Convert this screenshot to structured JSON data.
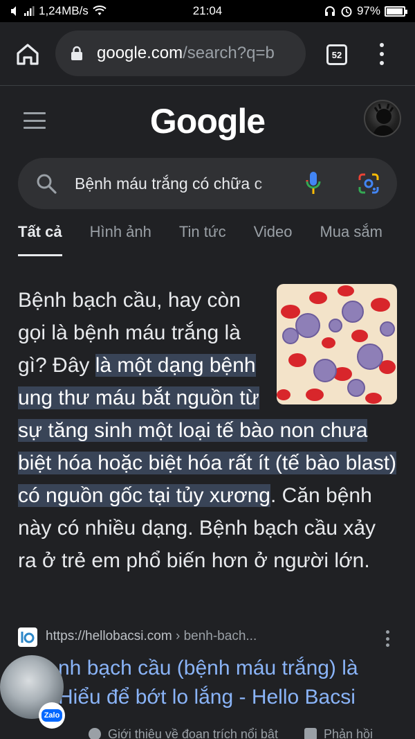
{
  "status_bar": {
    "speed": "1,24MB/s",
    "time": "21:04",
    "battery": "97%",
    "battery_level": 0.97
  },
  "browser": {
    "url_host": "google.com",
    "url_path": "/search?q=b",
    "tab_count": "52"
  },
  "header": {
    "logo": "Google"
  },
  "search": {
    "query": "Bệnh máu trắng có chữa c"
  },
  "tabs": [
    {
      "label": "Tất cả",
      "active": true
    },
    {
      "label": "Hình ảnh",
      "active": false
    },
    {
      "label": "Tin tức",
      "active": false
    },
    {
      "label": "Video",
      "active": false
    },
    {
      "label": "Mua sắm",
      "active": false
    }
  ],
  "snippet": {
    "pre": "Bệnh bạch cầu, hay còn gọi là bệnh máu trắng là gì? Đây ",
    "highlight": "là một dạng bệnh ung thư máu bắt nguồn từ sự tăng sinh một loại tế bào non chưa biệt hóa hoặc biệt hóa rất ít (tế bào blast) có nguồn gốc tại tủy xương",
    "post": ". Căn bệnh này có nhiều dạng. Bệnh bạch cầu xảy ra ở trẻ em phổ biến hơn ở người lớn."
  },
  "result": {
    "site": "https://hellobacsi.com",
    "path": " › benh-bach...",
    "title": "nh bạch cầu (bệnh máu trắng) là Hiểu để bớt lo lắng - Hello Bacsi"
  },
  "footer": {
    "about": "Giới thiệu về đoạn trích nổi bật",
    "feedback": "Phản hồi"
  },
  "zalo": {
    "label": "Zalo"
  },
  "colors": {
    "background": "#202124",
    "link": "#8ab4f8",
    "highlight": "#394457",
    "zalo": "#0068ff"
  }
}
